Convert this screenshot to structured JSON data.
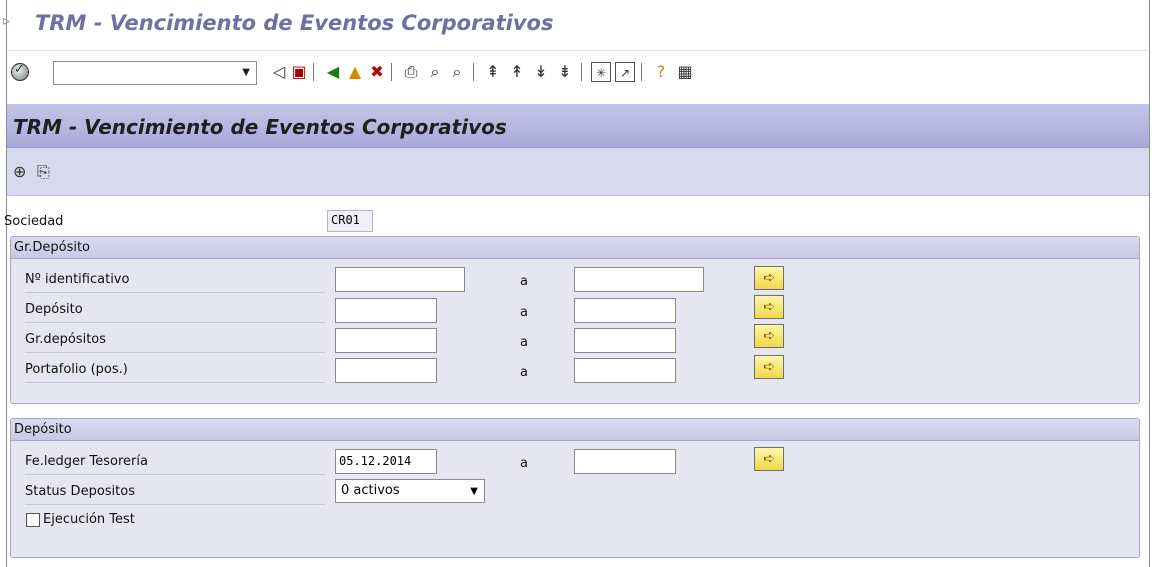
{
  "window": {
    "title": "TRM - Vencimiento de Eventos Corporativos"
  },
  "toolbar": {
    "command_value": ""
  },
  "header": {
    "title": "TRM - Vencimiento de Eventos Corporativos"
  },
  "form": {
    "sociedad": {
      "label": "Sociedad",
      "value": "CR01"
    },
    "grupo_deposito": {
      "title": "Gr.Depósito",
      "range_to_label": "a",
      "rows": [
        {
          "label": "Nº identificativo",
          "from": "",
          "to": ""
        },
        {
          "label": "Depósito",
          "from": "",
          "to": ""
        },
        {
          "label": "Gr.depósitos",
          "from": "",
          "to": ""
        },
        {
          "label": "Portafolio (pos.)",
          "from": "",
          "to": ""
        }
      ]
    },
    "deposito": {
      "title": "Depósito",
      "range_to_label": "a",
      "fe_ledger": {
        "label": "Fe.ledger Tesorería",
        "from": "05.12.2014",
        "to": ""
      },
      "status": {
        "label": "Status Depositos",
        "value": "0 activos"
      },
      "test_run": {
        "label": "Ejecución Test",
        "checked": false
      }
    }
  }
}
